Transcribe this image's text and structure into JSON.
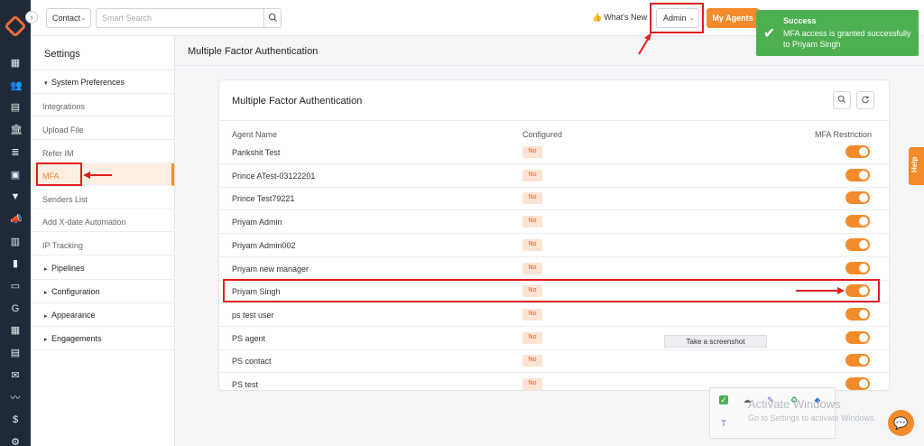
{
  "rail": {
    "icons": [
      "dashboard-icon",
      "contacts-icon",
      "documents-icon",
      "bank-icon",
      "list-icon",
      "contact-card-icon",
      "filter-icon",
      "megaphone-icon",
      "report-icon",
      "chart-icon",
      "folder-icon",
      "google-icon",
      "calendar-icon",
      "clipboard-icon",
      "mail-icon",
      "signature-icon",
      "dollar-icon",
      "gear-icon"
    ]
  },
  "topbar": {
    "contact_select": "Contact",
    "search_placeholder": "Smart Search",
    "whats_new": "What's New",
    "admin_select": "Admin",
    "my_agents": "My Agents"
  },
  "settings": {
    "title": "Settings",
    "system_preferences": "System Preferences",
    "sub_items": [
      "Integrations",
      "Upload File",
      "Refer IM",
      "MFA",
      "Senders List",
      "Add X-date Automation",
      "IP Tracking"
    ],
    "sections": [
      "Pipelines",
      "Configuration",
      "Appearance",
      "Engagements"
    ]
  },
  "main": {
    "page_title": "Multiple Factor Authentication",
    "card_title": "Multiple Factor Authentication",
    "columns": {
      "agent_name": "Agent Name",
      "configured": "Configured",
      "mfa_restriction": "MFA Restriction"
    },
    "rows": [
      {
        "name": "Parikshit Test",
        "configured": "No",
        "mfa_restriction": true
      },
      {
        "name": "Prince ATest-03122201",
        "configured": "No",
        "mfa_restriction": true
      },
      {
        "name": "Prince Test79221",
        "configured": "No",
        "mfa_restriction": true
      },
      {
        "name": "Priyam Admin",
        "configured": "No",
        "mfa_restriction": true
      },
      {
        "name": "Priyam Admin002",
        "configured": "No",
        "mfa_restriction": true
      },
      {
        "name": "Priyam new manager",
        "configured": "No",
        "mfa_restriction": true
      },
      {
        "name": "Priyam Singh",
        "configured": "No",
        "mfa_restriction": true
      },
      {
        "name": "ps test user",
        "configured": "No",
        "mfa_restriction": true
      },
      {
        "name": "PS agent",
        "configured": "No",
        "mfa_restriction": true
      },
      {
        "name": "PS contact",
        "configured": "No",
        "mfa_restriction": true
      },
      {
        "name": "PS test",
        "configured": "No",
        "mfa_restriction": true
      }
    ]
  },
  "toast": {
    "title": "Success",
    "message": "MFA access is granted successfully to Priyam Singh"
  },
  "help": "Help",
  "tooltip": "Take a screenshot",
  "watermark": {
    "line1": "Activate Windows",
    "line2": "Go to Settings to activate Windows."
  },
  "colors": {
    "accent": "#f38b2b",
    "highlight": "#e02020",
    "success": "#4caf50",
    "rail": "#1f2a38"
  }
}
